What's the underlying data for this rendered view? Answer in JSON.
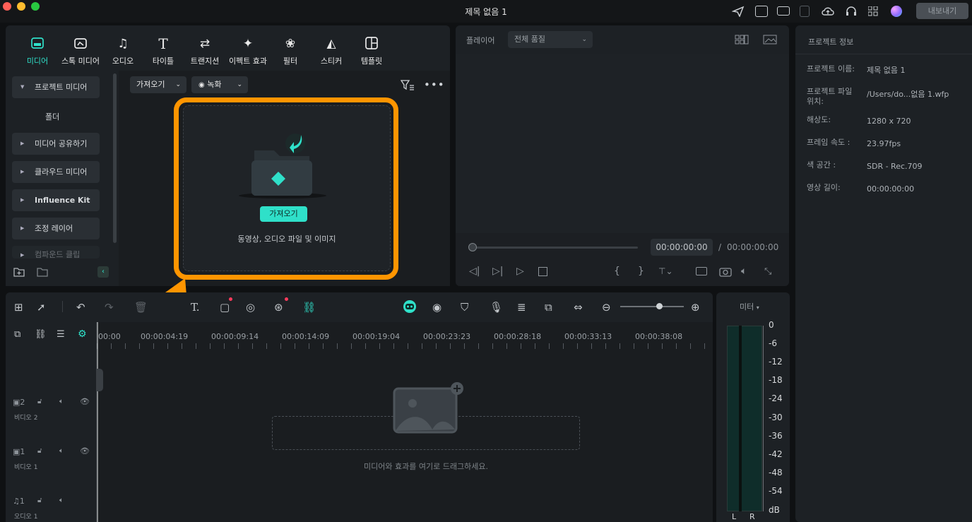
{
  "window": {
    "title": "제목 없음 1",
    "export_label": "내보내기"
  },
  "media_tabs": [
    {
      "label": "미디어",
      "icon": "media-icon",
      "active": true
    },
    {
      "label": "스톡 미디어",
      "icon": "stock-media-icon"
    },
    {
      "label": "오디오",
      "icon": "music-note-icon"
    },
    {
      "label": "타이틀",
      "icon": "text-t-icon"
    },
    {
      "label": "트랜지션",
      "icon": "transition-icon"
    },
    {
      "label": "이펙트 효과",
      "icon": "effects-sparkle-icon"
    },
    {
      "label": "필터",
      "icon": "filter-icon"
    },
    {
      "label": "스티커",
      "icon": "sticker-icon"
    },
    {
      "label": "템플릿",
      "icon": "template-icon"
    }
  ],
  "sidebar": {
    "items": [
      {
        "label": "프로젝트 미디어",
        "expanded": true
      },
      {
        "label": "폴더"
      },
      {
        "label": "미디어 공유하기"
      },
      {
        "label": "클라우드 미디어"
      },
      {
        "label": "Influence Kit"
      },
      {
        "label": "조정 레이어"
      },
      {
        "label": "컴파운드 클립"
      }
    ]
  },
  "media_toolbar": {
    "import_label": "가져오기",
    "record_label": "녹화"
  },
  "import_area": {
    "button_label": "가져오기",
    "hint": "동영상, 오디오 파일 및 이미지"
  },
  "player": {
    "label": "플레이어",
    "quality": "전체 품질",
    "current_time": "00:00:00:00",
    "separator": "/",
    "total_time": "00:00:00:00"
  },
  "project_info": {
    "title": "프로젝트 정보",
    "rows": [
      {
        "label": "프로젝트 이름:",
        "value": "제목 없음 1"
      },
      {
        "label": "프로젝트 파일 위치:",
        "value": "/Users/do...없음 1.wfp"
      },
      {
        "label": "해상도:",
        "value": "1280 x 720"
      },
      {
        "label": "프레임 속도 :",
        "value": "23.97fps"
      },
      {
        "label": "색 공간 :",
        "value": "SDR - Rec.709"
      },
      {
        "label": "영상 길이:",
        "value": "00:00:00:00"
      }
    ]
  },
  "timeline": {
    "ruler": [
      "00:00",
      "00:00:04:19",
      "00:00:09:14",
      "00:00:14:09",
      "00:00:19:04",
      "00:00:23:23",
      "00:00:28:18",
      "00:00:33:13",
      "00:00:38:08"
    ],
    "tracks": [
      {
        "num": "2",
        "label": "비디오 2"
      },
      {
        "num": "1",
        "label": "비디오 1"
      },
      {
        "num": "1",
        "label": "오디오 1"
      }
    ],
    "drop_hint": "미디어와 효과를 여기로 드래그하세요."
  },
  "meter": {
    "label": "미터",
    "scale": [
      "0",
      "-6",
      "-12",
      "-18",
      "-24",
      "-30",
      "-36",
      "-42",
      "-48",
      "-54",
      "dB"
    ],
    "channels": [
      "L",
      "R"
    ]
  },
  "colors": {
    "accent": "#2fe0c9",
    "highlight_orange": "#ff9500"
  }
}
